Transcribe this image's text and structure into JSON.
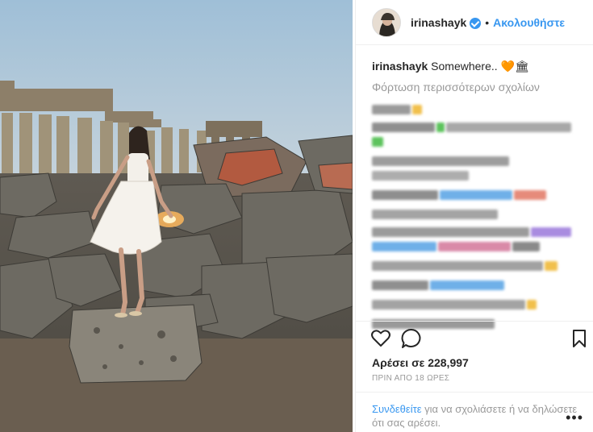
{
  "post": {
    "username": "irinashayk",
    "verified": true,
    "follow_label": "Ακολουθήστε",
    "separator": "•"
  },
  "caption": {
    "username": "irinashayk",
    "text": "Somewhere.. 🧡🏛"
  },
  "comments": {
    "load_more_label": "Φόρτωση περισσότερων σχολίων"
  },
  "stats": {
    "likes_label": "Αρέσει σε 228,997",
    "time_label": "ΠΡΙΝ ΑΠΟ 18 ΩΡΕΣ"
  },
  "login_prompt": {
    "link_label": "Συνδεθείτε",
    "text": " για να σχολιάσετε ή να δηλώσετε ότι σας αρέσει."
  },
  "icons": {
    "like": "heart-outline-icon",
    "comment": "comment-bubble-icon",
    "save": "bookmark-icon",
    "more": "more-options-icon"
  },
  "colors": {
    "link_blue": "#3897f0",
    "muted_text": "#999999",
    "border": "#efefef"
  }
}
